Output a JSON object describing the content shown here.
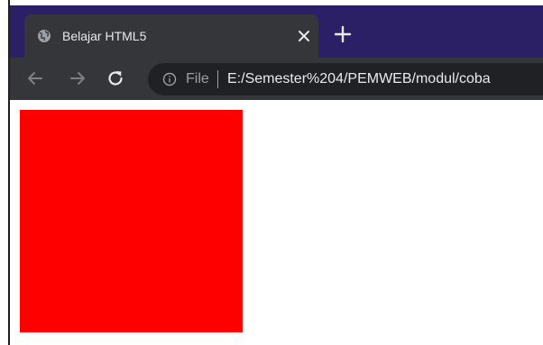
{
  "browser": {
    "tab": {
      "title": "Belajar HTML5",
      "icon": "globe-icon"
    },
    "new_tab_icon": "plus-icon",
    "close_icon": "close-icon",
    "nav": {
      "back_icon": "arrow-left-icon",
      "forward_icon": "arrow-right-icon",
      "reload_icon": "reload-icon"
    },
    "address": {
      "info_icon": "info-icon",
      "scheme_label": "File",
      "url": "E:/Semester%204/PEMWEB/modul/coba"
    }
  },
  "page": {
    "box_color": "#ff0000"
  },
  "colors": {
    "tabbar": "#2b1f66",
    "toolbar": "#35363a",
    "omnibox": "#202124"
  }
}
